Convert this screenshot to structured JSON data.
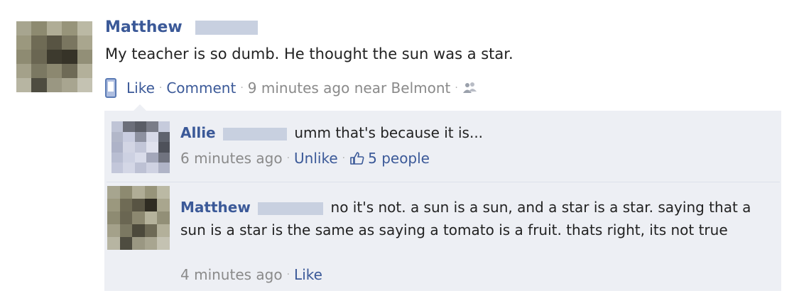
{
  "post": {
    "author": "Matthew",
    "text": "My teacher is so dumb. He thought the sun was a star.",
    "actions": {
      "like": "Like",
      "comment": "Comment",
      "time_location": "9 minutes ago near Belmont"
    }
  },
  "comments": [
    {
      "author": "Allie",
      "text": "umm that's because it is...",
      "time": "6 minutes ago",
      "unlike": "Unlike",
      "likes": "5 people"
    },
    {
      "author": "Matthew",
      "text": "no it's not. a sun is a sun, and a star is a star. saying that a sun is a star is the same as saying a tomato is a fruit. thats right, its not true",
      "time": "4 minutes ago",
      "like": "Like"
    }
  ],
  "icons": [
    "mobile-phone-icon",
    "friends-icon",
    "thumbs-up-icon"
  ],
  "colors": {
    "link": "#3b5998",
    "comment_bg": "#edeff4",
    "meta": "#8a8a8a"
  }
}
